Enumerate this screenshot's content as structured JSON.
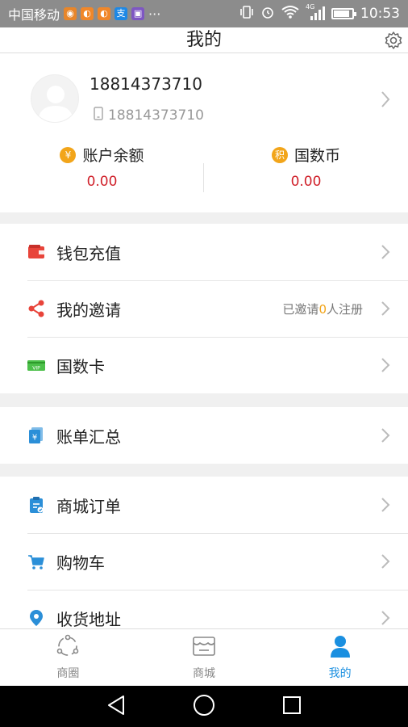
{
  "status_bar": {
    "carrier": "中国移动",
    "dots": "···",
    "network": "4G",
    "time": "10:53",
    "battery_level": 0.8
  },
  "header": {
    "title": "我的"
  },
  "profile": {
    "user_name": "18814373710",
    "phone": "18814373710",
    "balance_label": "账户余额",
    "balance_value": "0.00",
    "coin_label": "国数币",
    "coin_value": "0.00"
  },
  "menu": {
    "wallet_recharge": "钱包充值",
    "my_invitation": "我的邀请",
    "invite_prefix": "已邀请",
    "invite_count": "0",
    "invite_suffix": "人注册",
    "card": "国数卡",
    "bill_summary": "账单汇总",
    "mall_orders": "商城订单",
    "cart": "购物车",
    "address": "收货地址"
  },
  "tabbar": {
    "circle": "商圈",
    "mall": "商城",
    "mine": "我的"
  },
  "colors": {
    "accent": "#1a8fe0",
    "amount_red": "#d0202a",
    "coin_orange": "#f2a51a",
    "wallet_red": "#e8443a",
    "vip_green": "#4cc04a"
  }
}
